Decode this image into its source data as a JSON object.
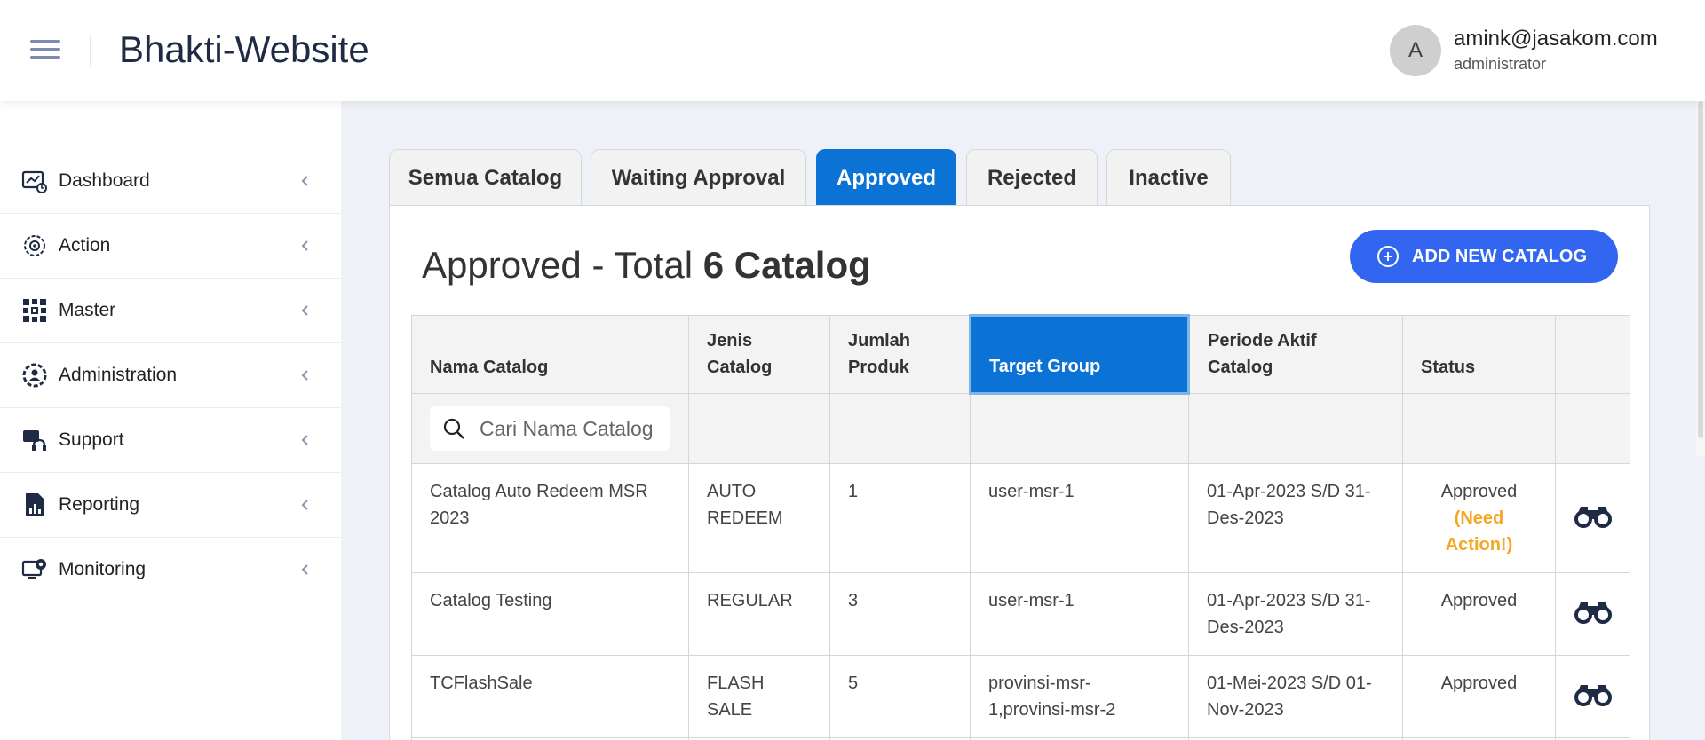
{
  "header": {
    "title": "Bhakti-Website",
    "avatar_letter": "A",
    "user_email": "amink@jasakom.com",
    "user_role": "administrator"
  },
  "sidebar": {
    "items": [
      {
        "label": "Dashboard",
        "icon": "dashboard-icon"
      },
      {
        "label": "Action",
        "icon": "action-icon"
      },
      {
        "label": "Master",
        "icon": "master-icon"
      },
      {
        "label": "Administration",
        "icon": "administration-icon"
      },
      {
        "label": "Support",
        "icon": "support-icon"
      },
      {
        "label": "Reporting",
        "icon": "reporting-icon"
      },
      {
        "label": "Monitoring",
        "icon": "monitoring-icon"
      }
    ]
  },
  "tabs": [
    {
      "label": "Semua Catalog"
    },
    {
      "label": "Waiting Approval"
    },
    {
      "label": "Approved",
      "active": true
    },
    {
      "label": "Rejected"
    },
    {
      "label": "Inactive"
    }
  ],
  "page": {
    "title_prefix": "Approved - Total ",
    "title_count": "6 Catalog",
    "add_button_label": "ADD NEW CATALOG"
  },
  "table": {
    "columns": [
      "Nama Catalog",
      "Jenis Catalog",
      "Jumlah Produk",
      "Target Group",
      "Periode Aktif Catalog",
      "Status",
      ""
    ],
    "search_placeholder": "Cari Nama Catalog",
    "rows": [
      {
        "nama": "Catalog Auto Redeem MSR 2023",
        "jenis": "AUTO REDEEM",
        "jumlah": "1",
        "target": "user-msr-1",
        "periode": "01-Apr-2023 S/D 31-Des-2023",
        "status": "Approved",
        "status_note": "(Need Action!)"
      },
      {
        "nama": "Catalog Testing",
        "jenis": "REGULAR",
        "jumlah": "3",
        "target": "user-msr-1",
        "periode": "01-Apr-2023 S/D 31-Des-2023",
        "status": "Approved",
        "status_note": ""
      },
      {
        "nama": "TCFlashSale",
        "jenis": "FLASH SALE",
        "jumlah": "5",
        "target": "provinsi-msr-1,provinsi-msr-2",
        "periode": "01-Mei-2023 S/D 01-Nov-2023",
        "status": "Approved",
        "status_note": ""
      }
    ]
  },
  "colors": {
    "accent_tab": "#0a73d5",
    "add_button": "#3366f0",
    "need_action": "#f5a623",
    "icon_navy": "#1f2a44"
  }
}
